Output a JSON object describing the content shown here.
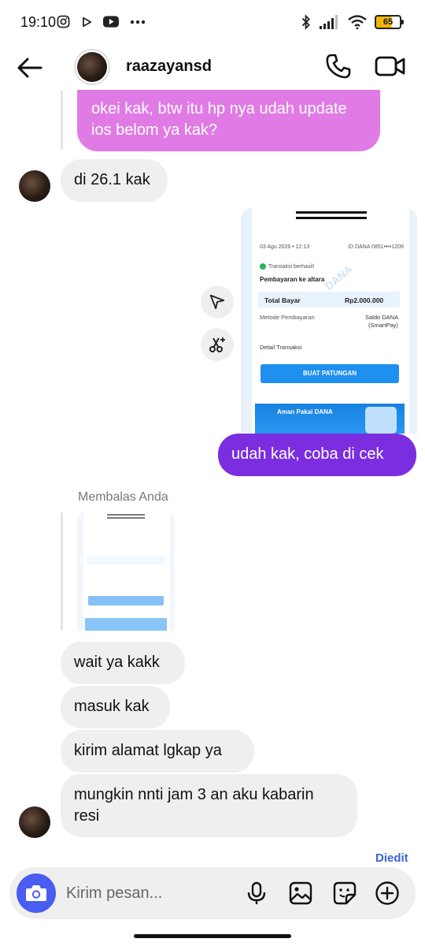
{
  "status_bar": {
    "time": "19:10",
    "battery": "65",
    "left_icons": [
      "instagram-icon",
      "play-icon",
      "youtube-icon",
      "more-dots-icon"
    ],
    "right_icons": [
      "bluetooth-icon",
      "signal-icon",
      "wifi-icon",
      "battery-icon"
    ]
  },
  "header": {
    "contact_name": "raazayansd",
    "icons": [
      "back-arrow-icon",
      "phone-icon",
      "video-icon"
    ]
  },
  "messages": {
    "m1": {
      "line1": "okei kak, btw itu hp nya udah update",
      "line2": "ios belom ya kak?"
    },
    "m2": "di 26.1 kak",
    "m4": "udah kak, coba di cek",
    "reply_label": "Membalas Anda",
    "m5": "wait ya kakk",
    "m6": "masuk kak",
    "m7": "kirim alamat lgkap ya",
    "m8": {
      "line1": "mungkin nnti jam 3 an aku kabarin",
      "line2": "resi"
    },
    "edited": "Diedit"
  },
  "receipt": {
    "date": "03 Agu 2026 • 12:13",
    "id": "ID DANA 0851••••1209",
    "status": "Transaksi berhasil!",
    "title": "Pembayaran ke altara",
    "total_label": "Total Bayar",
    "total_value": "Rp2.000.000",
    "method_label": "Metode Pembayaran",
    "method_value_1": "Saldo DANA",
    "method_value_2": "(SmartPay)",
    "detail_label": "Detail Transaksi",
    "button": "BUAT PATUNGAN",
    "banner": "Aman Pakai DANA",
    "watermark": "DANA"
  },
  "composer": {
    "placeholder": "Kirim pesan...",
    "icons": [
      "camera-icon",
      "microphone-icon",
      "image-icon",
      "sticker-icon",
      "plus-icon"
    ]
  },
  "colors": {
    "pink_bubble": "#e07ae4",
    "purple_bubble": "#7b2ee0",
    "received_bubble": "#efefef",
    "camera_button": "#4a5df0",
    "edited_label": "#3b63d9"
  }
}
